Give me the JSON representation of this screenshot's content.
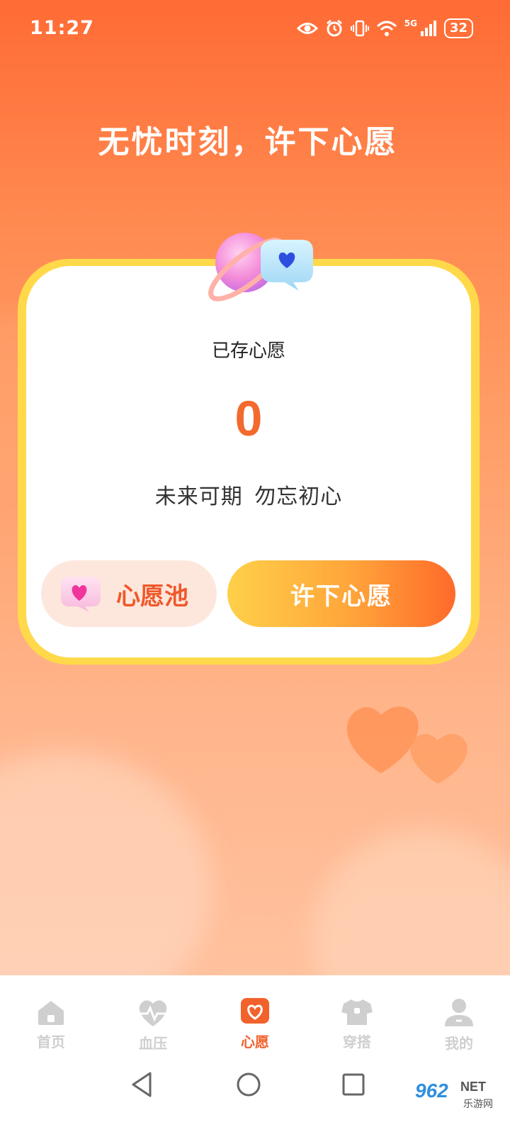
{
  "status_bar": {
    "time": "11:27",
    "network": "5G",
    "battery": "32",
    "icons": [
      "eye-icon",
      "alarm-icon",
      "vibrate-icon",
      "wifi-icon",
      "signal-icon",
      "battery-icon"
    ]
  },
  "headline": "无忧时刻，许下心愿",
  "card": {
    "saved_label": "已存心愿",
    "saved_count": "0",
    "motto": "未来可期 勿忘初心",
    "pool_button": "心愿池",
    "make_wish_button": "许下心愿"
  },
  "tabbar": {
    "items": [
      {
        "label": "首页",
        "icon": "home-icon",
        "active": false
      },
      {
        "label": "血压",
        "icon": "heart-pulse-icon",
        "active": false
      },
      {
        "label": "心愿",
        "icon": "wish-heart-icon",
        "active": true
      },
      {
        "label": "穿搭",
        "icon": "shirt-icon",
        "active": false
      },
      {
        "label": "我的",
        "icon": "user-icon",
        "active": false
      }
    ]
  },
  "watermark": {
    "brand_number": "962",
    "brand_suffix": "NET",
    "brand_sub": "乐游网"
  },
  "colors": {
    "accent": "#f2622c",
    "card_border": "#ffd94a",
    "button_gradient_start": "#ffd04a",
    "button_gradient_end": "#ff6a2a",
    "inactive_tab": "#cfcfcf"
  }
}
